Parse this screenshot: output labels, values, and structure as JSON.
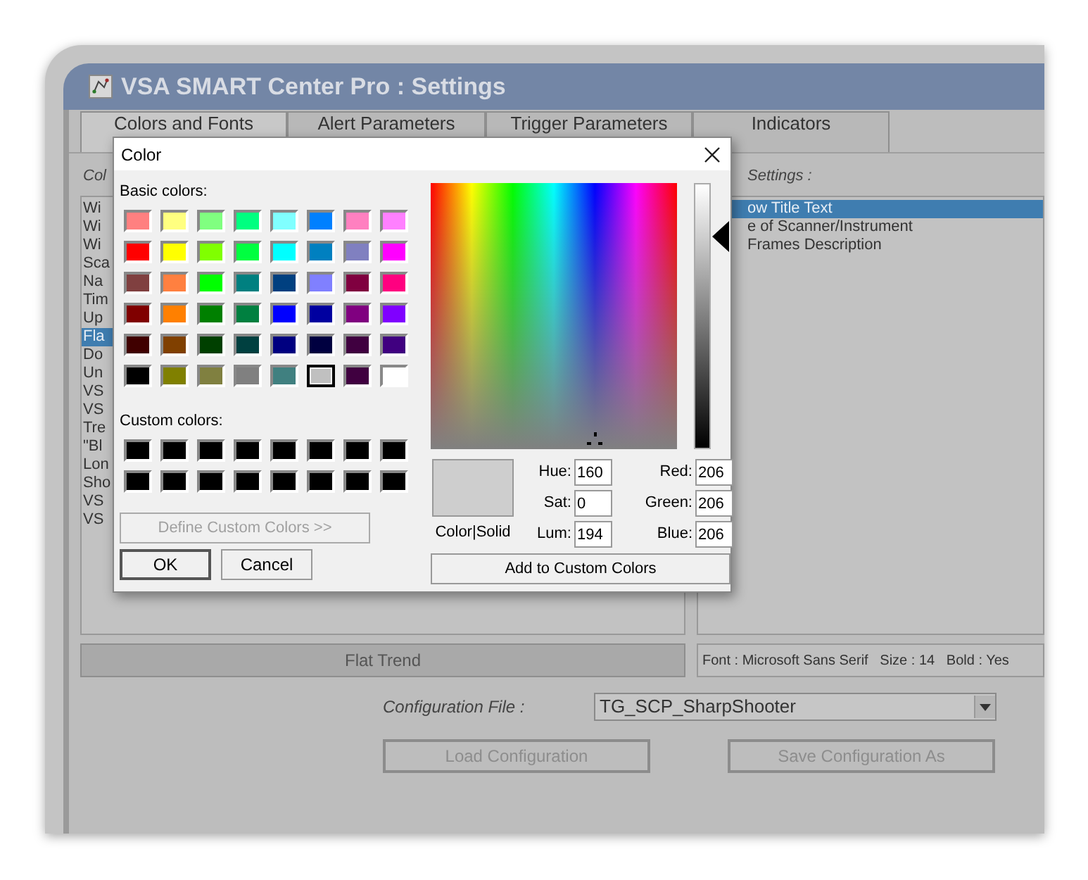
{
  "window": {
    "title": "VSA SMART Center Pro : Settings"
  },
  "tabs": [
    {
      "label": "Colors and Fonts",
      "selected": true
    },
    {
      "label": "Alert Parameters",
      "selected": false
    },
    {
      "label": "Trigger Parameters",
      "selected": false
    },
    {
      "label": "Indicators",
      "selected": false
    }
  ],
  "left_panel": {
    "label": "Col",
    "items": [
      {
        "text": "Wi",
        "selected": false
      },
      {
        "text": "Wi",
        "selected": false
      },
      {
        "text": "Wi",
        "selected": false
      },
      {
        "text": "Sca",
        "selected": false
      },
      {
        "text": "Na",
        "selected": false
      },
      {
        "text": "Tim",
        "selected": false
      },
      {
        "text": "Up",
        "selected": false
      },
      {
        "text": "Fla",
        "selected": true
      },
      {
        "text": "Do",
        "selected": false
      },
      {
        "text": "Un",
        "selected": false
      },
      {
        "text": "VS",
        "selected": false
      },
      {
        "text": "VS",
        "selected": false
      },
      {
        "text": "Tre",
        "selected": false
      },
      {
        "text": "\"Bl",
        "selected": false
      },
      {
        "text": "Lon",
        "selected": false
      },
      {
        "text": "Sho",
        "selected": false
      },
      {
        "text": "VS",
        "selected": false
      },
      {
        "text": "VS",
        "selected": false
      }
    ]
  },
  "right_panel": {
    "label": "Settings :",
    "items": [
      {
        "text": "ow Title Text",
        "selected": true
      },
      {
        "text": "e of Scanner/Instrument",
        "selected": false
      },
      {
        "text": "Frames Description",
        "selected": false
      }
    ]
  },
  "preview_bar": "Flat Trend",
  "font_info": "Font : Microsoft Sans Serif   Size : 14   Bold : Yes",
  "configuration": {
    "label": "Configuration File :",
    "value": "TG_SCP_SharpShooter"
  },
  "buttons": [
    {
      "label": "Load Configuration",
      "disabled": true
    },
    {
      "label": "Save Configuration As",
      "disabled": true
    }
  ],
  "color_dialog": {
    "title": "Color",
    "basic_label": "Basic colors:",
    "basic_colors": [
      {
        "color": "#ff8080",
        "selected": false
      },
      {
        "color": "#ffff80",
        "selected": false
      },
      {
        "color": "#80ff80",
        "selected": false
      },
      {
        "color": "#00ff80",
        "selected": false
      },
      {
        "color": "#80ffff",
        "selected": false
      },
      {
        "color": "#0080ff",
        "selected": false
      },
      {
        "color": "#ff80c0",
        "selected": false
      },
      {
        "color": "#ff80ff",
        "selected": false
      },
      {
        "color": "#ff0000",
        "selected": false
      },
      {
        "color": "#ffff00",
        "selected": false
      },
      {
        "color": "#80ff00",
        "selected": false
      },
      {
        "color": "#00ff40",
        "selected": false
      },
      {
        "color": "#00ffff",
        "selected": false
      },
      {
        "color": "#0080c0",
        "selected": false
      },
      {
        "color": "#8080c0",
        "selected": false
      },
      {
        "color": "#ff00ff",
        "selected": false
      },
      {
        "color": "#804040",
        "selected": false
      },
      {
        "color": "#ff8040",
        "selected": false
      },
      {
        "color": "#00ff00",
        "selected": false
      },
      {
        "color": "#008080",
        "selected": false
      },
      {
        "color": "#004080",
        "selected": false
      },
      {
        "color": "#8080ff",
        "selected": false
      },
      {
        "color": "#800040",
        "selected": false
      },
      {
        "color": "#ff0080",
        "selected": false
      },
      {
        "color": "#800000",
        "selected": false
      },
      {
        "color": "#ff8000",
        "selected": false
      },
      {
        "color": "#008000",
        "selected": false
      },
      {
        "color": "#008040",
        "selected": false
      },
      {
        "color": "#0000ff",
        "selected": false
      },
      {
        "color": "#0000a0",
        "selected": false
      },
      {
        "color": "#800080",
        "selected": false
      },
      {
        "color": "#8000ff",
        "selected": false
      },
      {
        "color": "#400000",
        "selected": false
      },
      {
        "color": "#804000",
        "selected": false
      },
      {
        "color": "#004000",
        "selected": false
      },
      {
        "color": "#004040",
        "selected": false
      },
      {
        "color": "#000080",
        "selected": false
      },
      {
        "color": "#000040",
        "selected": false
      },
      {
        "color": "#400040",
        "selected": false
      },
      {
        "color": "#400080",
        "selected": false
      },
      {
        "color": "#000000",
        "selected": false
      },
      {
        "color": "#808000",
        "selected": false
      },
      {
        "color": "#808040",
        "selected": false
      },
      {
        "color": "#808080",
        "selected": false
      },
      {
        "color": "#408080",
        "selected": false
      },
      {
        "color": "#c0c0c0",
        "selected": true
      },
      {
        "color": "#400040",
        "selected": false
      },
      {
        "color": "#ffffff",
        "selected": false
      }
    ],
    "custom_label": "Custom colors:",
    "define_button": {
      "label": "Define Custom Colors >>",
      "disabled": true
    },
    "ok_label": "OK",
    "cancel_label": "Cancel",
    "preview_label": "Color|Solid",
    "fields": [
      {
        "label": "Hue:",
        "value": "160"
      },
      {
        "label": "Red:",
        "value": "206"
      },
      {
        "label": "Sat:",
        "value": "0"
      },
      {
        "label": "Green:",
        "value": "206"
      },
      {
        "label": "Lum:",
        "value": "194"
      },
      {
        "label": "Blue:",
        "value": "206"
      }
    ],
    "luminance": {
      "level": 0.8
    },
    "add_button": "Add to Custom Colors"
  }
}
